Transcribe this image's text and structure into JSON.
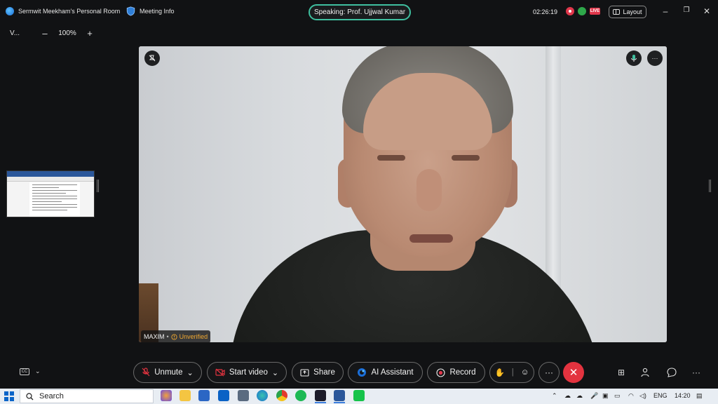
{
  "header": {
    "room_title": "Sermwit Meekham's Personal Room",
    "meeting_info": "Meeting Info",
    "speaking": "Speaking: Prof. Ujjwal Kumar",
    "timer": "02:26:19",
    "live_badge": "LIVE",
    "layout_label": "Layout",
    "window_controls": [
      "–",
      "❐",
      "✕"
    ]
  },
  "zoom": {
    "view_label": "V...",
    "minus": "–",
    "level": "100%",
    "plus": "+"
  },
  "video": {
    "participant_name": "MAXIM",
    "separator": "•",
    "status": "Unverified"
  },
  "controls": {
    "cc_label": "CC",
    "unmute": "Unmute",
    "start_video": "Start video",
    "share": "Share",
    "ai_assistant": "AI Assistant",
    "record": "Record",
    "more": "···",
    "end": "✕"
  },
  "taskbar": {
    "search_placeholder": "Search",
    "language": "ENG",
    "time": "14:20"
  },
  "colors": {
    "accent_speaking": "#3fbf9f",
    "end_call": "#e3333f",
    "record": "#e0374b",
    "unverified": "#f0a830"
  }
}
